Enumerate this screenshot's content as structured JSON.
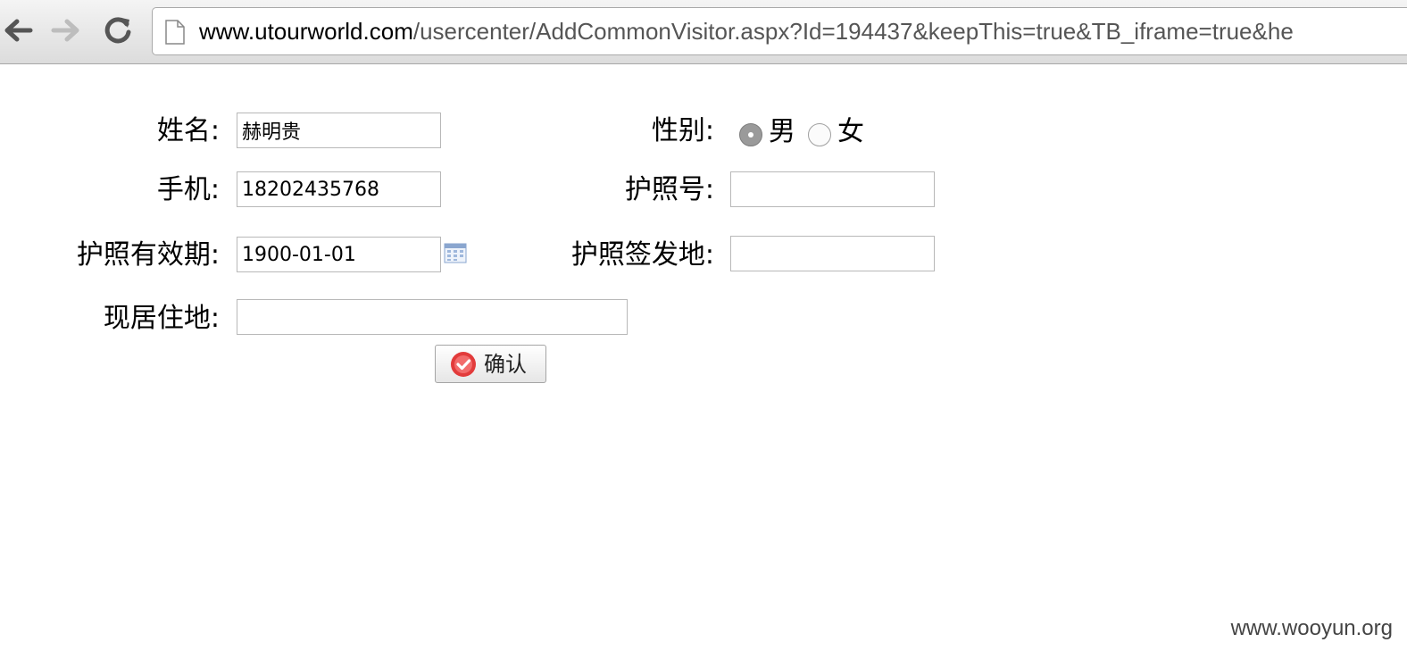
{
  "browser": {
    "url_host": "www.utourworld.com",
    "url_path": "/usercenter/AddCommonVisitor.aspx?Id=194437&keepThis=true&TB_iframe=true&he"
  },
  "form": {
    "name_label": "姓名:",
    "name_value": "赫明贵",
    "gender_label": "性别:",
    "gender_male": "男",
    "gender_female": "女",
    "gender_selected": "男",
    "phone_label": "手机:",
    "phone_value": "18202435768",
    "passport_no_label": "护照号:",
    "passport_no_value": "",
    "passport_expiry_label": "护照有效期:",
    "passport_expiry_value": "1900-01-01",
    "passport_issue_place_label": "护照签发地:",
    "passport_issue_place_value": "",
    "address_label": "现居住地:",
    "address_value": "",
    "confirm_label": "确认"
  },
  "watermark": "www.wooyun.org",
  "icons": [
    "back-arrow-icon",
    "forward-arrow-icon",
    "reload-icon",
    "page-icon",
    "calendar-icon",
    "checkmark-icon"
  ]
}
